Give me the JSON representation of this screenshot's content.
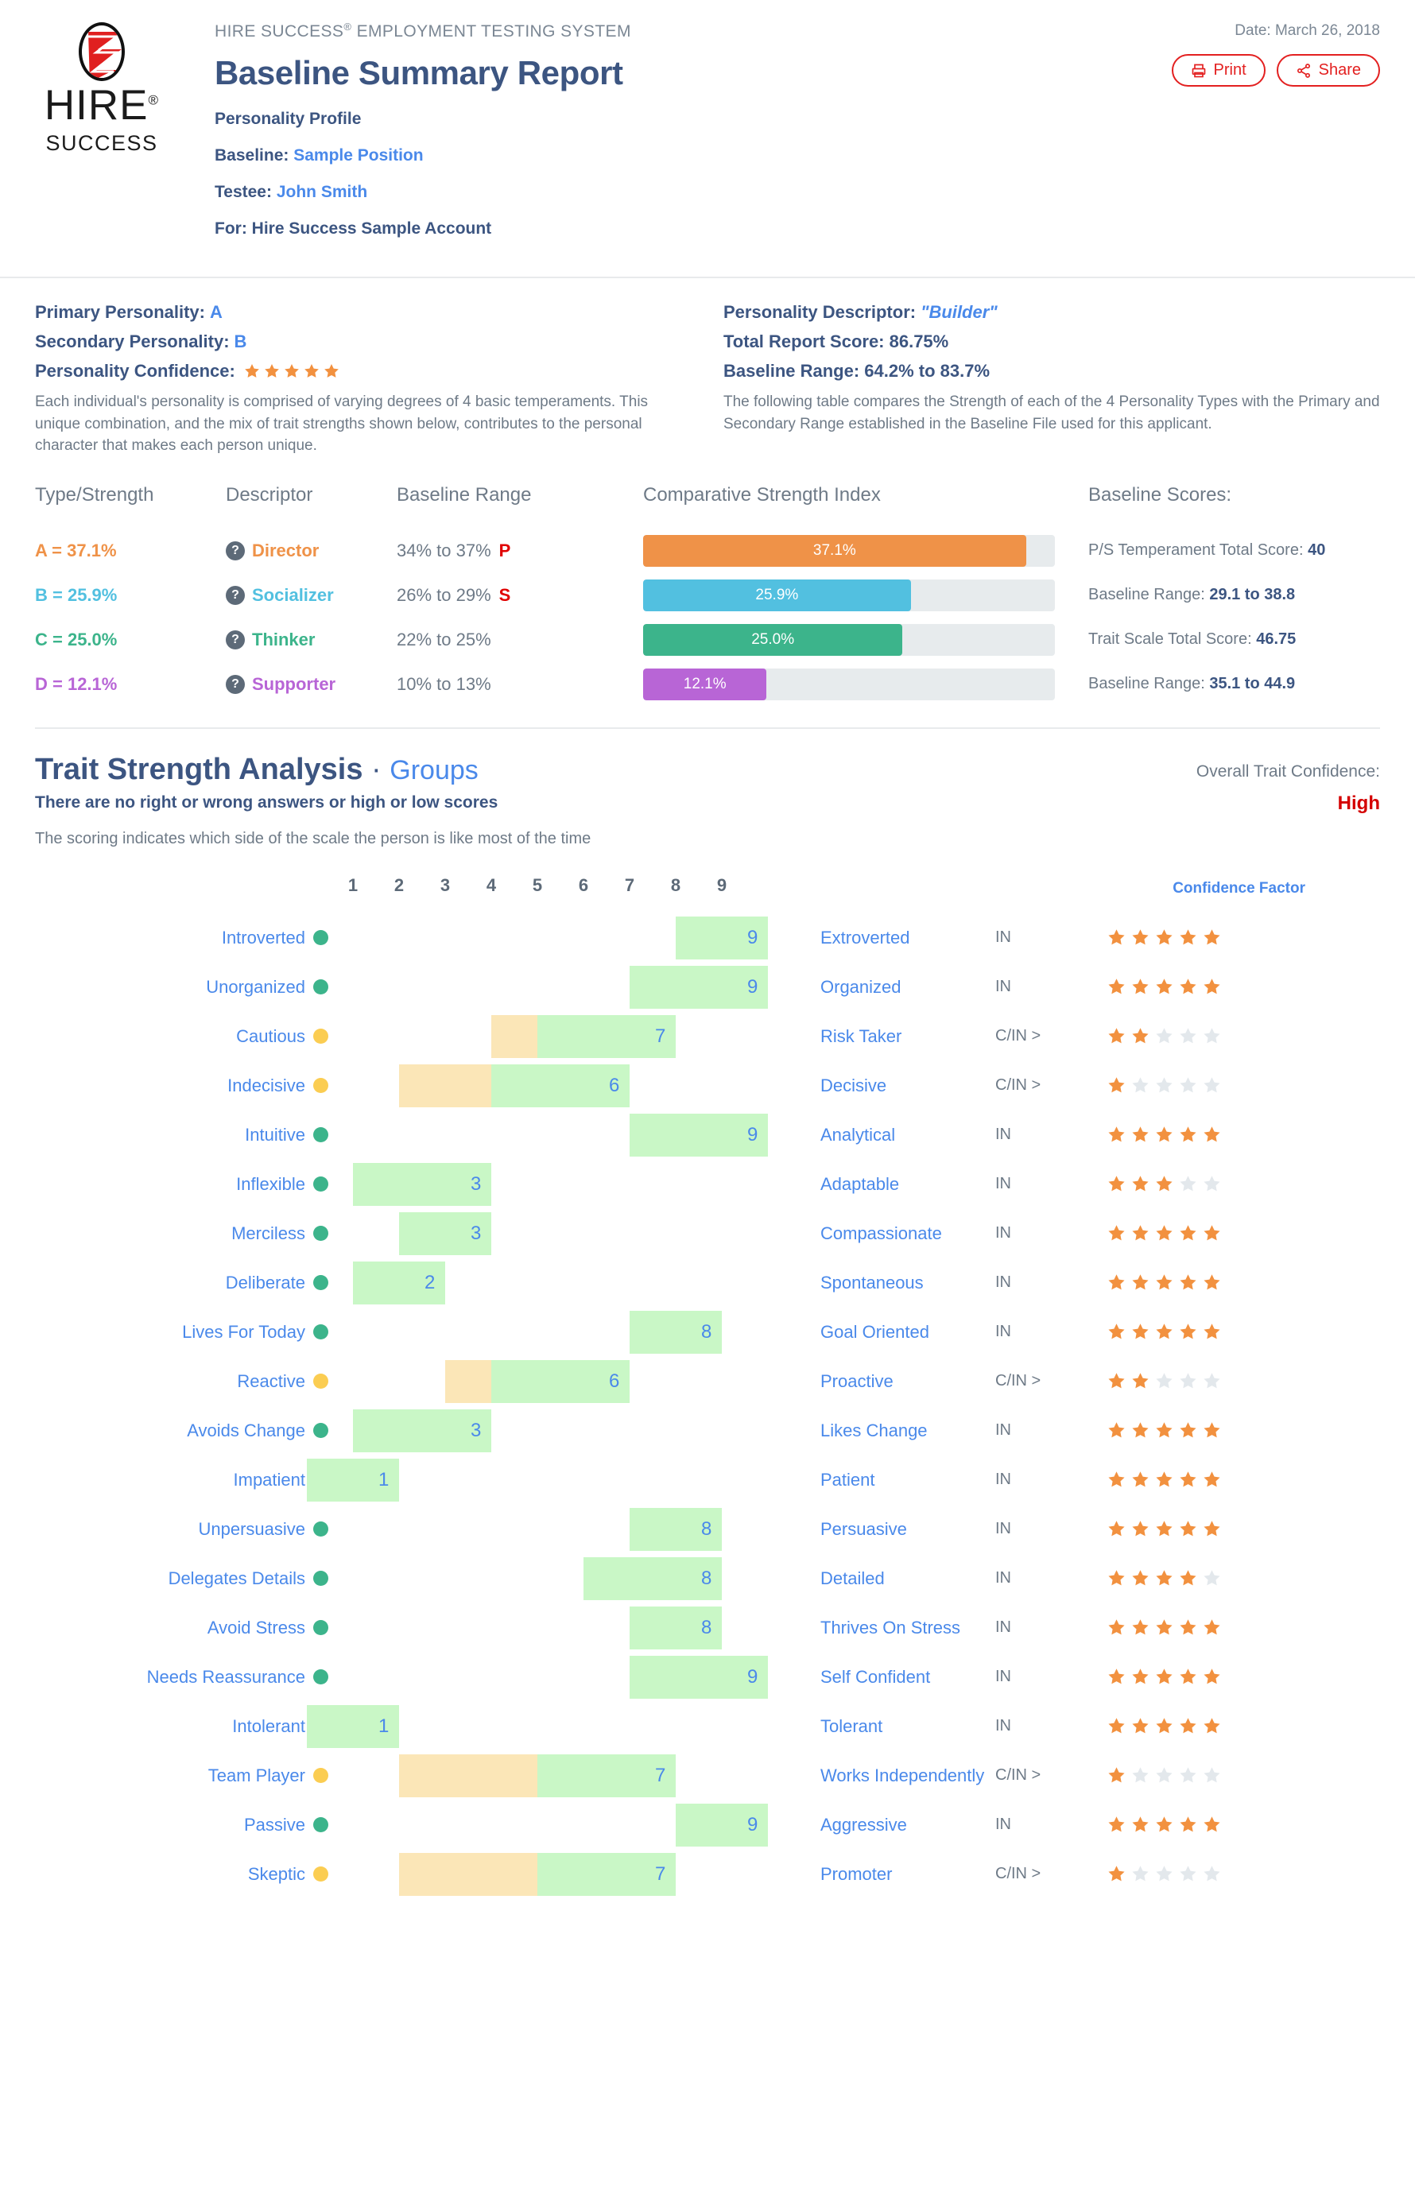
{
  "header": {
    "eyebrow": "HIRE SUCCESS",
    "eyebrow_sup": "®",
    "eyebrow_rest": " EMPLOYMENT TESTING SYSTEM",
    "title": "Baseline Summary Report",
    "subtitle": "Personality Profile",
    "baseline_label": "Baseline:",
    "baseline_value": "Sample Position",
    "testee_label": "Testee:",
    "testee_value": "John Smith",
    "for_label": "For:",
    "for_value": "Hire Success Sample Account",
    "date": "Date: March 26, 2018",
    "print_label": "Print",
    "share_label": "Share",
    "logo_word": "HIRE",
    "logo_reg": "®",
    "logo_sub": "SUCCESS"
  },
  "summary": {
    "left": {
      "primary_label": "Primary Personality:",
      "primary_value": "A",
      "secondary_label": "Secondary Personality:",
      "secondary_value": "B",
      "confidence_label": "Personality Confidence:",
      "confidence_stars": 5,
      "paragraph": "Each individual's personality is comprised of varying degrees of 4 basic temperaments. This unique combination, and the mix of trait strengths shown below, contributes to the personal character that makes each person unique."
    },
    "right": {
      "descriptor_label": "Personality Descriptor:",
      "descriptor_value": "\"Builder\"",
      "total_label": "Total Report Score: 86.75%",
      "range_label": "Baseline Range: 64.2% to 83.7%",
      "paragraph": "The following table compares the Strength of each of the 4 Personality Types with the Primary and Secondary Range established in the Baseline File used for this applicant."
    }
  },
  "type_table": {
    "headers": {
      "type": "Type/Strength",
      "descriptor": "Descriptor",
      "range": "Baseline Range",
      "index": "Comparative Strength Index",
      "scores": "Baseline Scores:"
    },
    "rows": [
      {
        "type": "A = 37.1%",
        "descriptor": "Director",
        "range": "34% to 37%",
        "flag": "P",
        "pct": 37.1,
        "bar_label": "37.1%",
        "color": "#ef9248"
      },
      {
        "type": "B = 25.9%",
        "descriptor": "Socializer",
        "range": "26% to 29%",
        "flag": "S",
        "pct": 25.9,
        "bar_label": "25.9%",
        "color": "#52c0e0"
      },
      {
        "type": "C = 25.0%",
        "descriptor": "Thinker",
        "range": "22% to 25%",
        "flag": "",
        "pct": 25.0,
        "bar_label": "25.0%",
        "color": "#3cb48b"
      },
      {
        "type": "D = 12.1%",
        "descriptor": "Supporter",
        "range": "10% to 13%",
        "flag": "",
        "pct": 12.1,
        "bar_label": "12.1%",
        "color": "#b865d6"
      }
    ],
    "scores": [
      {
        "label": "P/S Temperament Total Score: ",
        "value": "40"
      },
      {
        "label": "Baseline Range: ",
        "value": "29.1 to 38.8"
      },
      {
        "label": "Trait Scale Total Score: ",
        "value": "46.75"
      },
      {
        "label": "Baseline Range: ",
        "value": "35.1 to 44.9"
      }
    ]
  },
  "trait_section": {
    "title": "Trait Strength Analysis",
    "title_sep": "·",
    "title_link": "Groups",
    "subtitle": "There are no right or wrong answers or high or low scores",
    "note": "The scoring indicates which side of the scale the person is like most of the time",
    "overall_label": "Overall Trait Confidence:",
    "overall_value": "High",
    "confidence_factor_label": "Confidence Factor",
    "scale": [
      1,
      2,
      3,
      4,
      5,
      6,
      7,
      8,
      9
    ]
  },
  "chart_data": {
    "type": "bar",
    "title": "Trait Strength Analysis",
    "xlabel": "",
    "ylabel": "",
    "xlim": [
      1,
      9
    ],
    "grid": false,
    "legend": "none",
    "scale_ticks": [
      1,
      2,
      3,
      4,
      5,
      6,
      7,
      8,
      9
    ],
    "columns": [
      "left_trait",
      "dot",
      "score",
      "range_start",
      "right_trait",
      "code",
      "confidence_stars"
    ],
    "rows": [
      {
        "left": "Introverted",
        "right": "Extroverted",
        "score": 9,
        "range_start": 8,
        "dot": "green",
        "code": "IN",
        "stars": 5
      },
      {
        "left": "Unorganized",
        "right": "Organized",
        "score": 9,
        "range_start": 7,
        "dot": "green",
        "code": "IN",
        "stars": 5
      },
      {
        "left": "Cautious",
        "right": "Risk Taker",
        "score": 7,
        "range_start": 4,
        "dot": "amber",
        "code": "C/IN >",
        "stars": 2
      },
      {
        "left": "Indecisive",
        "right": "Decisive",
        "score": 6,
        "range_start": 2,
        "dot": "amber",
        "code": "C/IN >",
        "stars": 1
      },
      {
        "left": "Intuitive",
        "right": "Analytical",
        "score": 9,
        "range_start": 7,
        "dot": "green",
        "code": "IN",
        "stars": 5
      },
      {
        "left": "Inflexible",
        "right": "Adaptable",
        "score": 3,
        "range_start": 1,
        "dot": "green",
        "code": "IN",
        "stars": 3
      },
      {
        "left": "Merciless",
        "right": "Compassionate",
        "score": 3,
        "range_start": 2,
        "dot": "green",
        "code": "IN",
        "stars": 5
      },
      {
        "left": "Deliberate",
        "right": "Spontaneous",
        "score": 2,
        "range_start": 1,
        "dot": "green",
        "code": "IN",
        "stars": 5
      },
      {
        "left": "Lives For Today",
        "right": "Goal Oriented",
        "score": 8,
        "range_start": 7,
        "dot": "green",
        "code": "IN",
        "stars": 5
      },
      {
        "left": "Reactive",
        "right": "Proactive",
        "score": 6,
        "range_start": 3,
        "dot": "amber",
        "code": "C/IN >",
        "stars": 2
      },
      {
        "left": "Avoids Change",
        "right": "Likes Change",
        "score": 3,
        "range_start": 1,
        "dot": "green",
        "code": "IN",
        "stars": 5
      },
      {
        "left": "Impatient",
        "right": "Patient",
        "score": 1,
        "range_start": 0,
        "dot": "green",
        "code": "IN",
        "stars": 5
      },
      {
        "left": "Unpersuasive",
        "right": "Persuasive",
        "score": 8,
        "range_start": 7,
        "dot": "green",
        "code": "IN",
        "stars": 5
      },
      {
        "left": "Delegates Details",
        "right": "Detailed",
        "score": 8,
        "range_start": 6,
        "dot": "green",
        "code": "IN",
        "stars": 4
      },
      {
        "left": "Avoid Stress",
        "right": "Thrives On Stress",
        "score": 8,
        "range_start": 7,
        "dot": "green",
        "code": "IN",
        "stars": 5
      },
      {
        "left": "Needs Reassurance",
        "right": "Self Confident",
        "score": 9,
        "range_start": 7,
        "dot": "green",
        "code": "IN",
        "stars": 5
      },
      {
        "left": "Intolerant",
        "right": "Tolerant",
        "score": 1,
        "range_start": 0,
        "dot": "green",
        "code": "IN",
        "stars": 5
      },
      {
        "left": "Team Player",
        "right": "Works Independently",
        "score": 7,
        "range_start": 2,
        "dot": "amber",
        "code": "C/IN >",
        "stars": 1
      },
      {
        "left": "Passive",
        "right": "Aggressive",
        "score": 9,
        "range_start": 8,
        "dot": "green",
        "code": "IN",
        "stars": 5
      },
      {
        "left": "Skeptic",
        "right": "Promoter",
        "score": 7,
        "range_start": 2,
        "dot": "amber",
        "code": "C/IN >",
        "stars": 1
      }
    ]
  },
  "colors": {
    "link": "#4a89ea",
    "navy": "#3c5581",
    "muted": "#6e7a87",
    "red": "#e32020",
    "star_on": "#f2913f",
    "star_off": "#e3e8ec",
    "green_dot": "#3cb48b",
    "amber_dot": "#fbcd52",
    "seg_green": "#c9f7c6",
    "seg_amber": "#fbe6b7"
  }
}
